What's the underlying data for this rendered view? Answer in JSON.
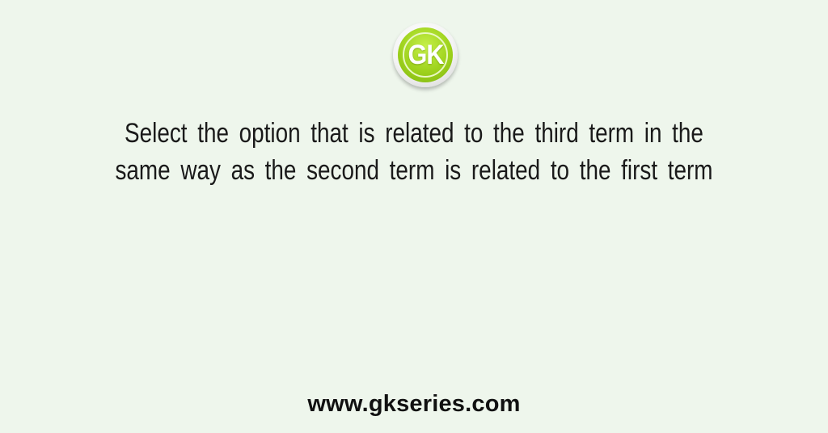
{
  "logo": {
    "text": "GK",
    "icon": "gk-logo-circle",
    "colors": {
      "green": "#9ed21c",
      "ring": "#ffffff"
    }
  },
  "question": {
    "lines": [
      "Select the option that is related to the third term in the",
      "same way as the second term is related to the first term"
    ]
  },
  "footer": {
    "url": "www.gkseries.com"
  },
  "colors": {
    "background": "#eef6ec",
    "text": "#1a1a1a"
  }
}
